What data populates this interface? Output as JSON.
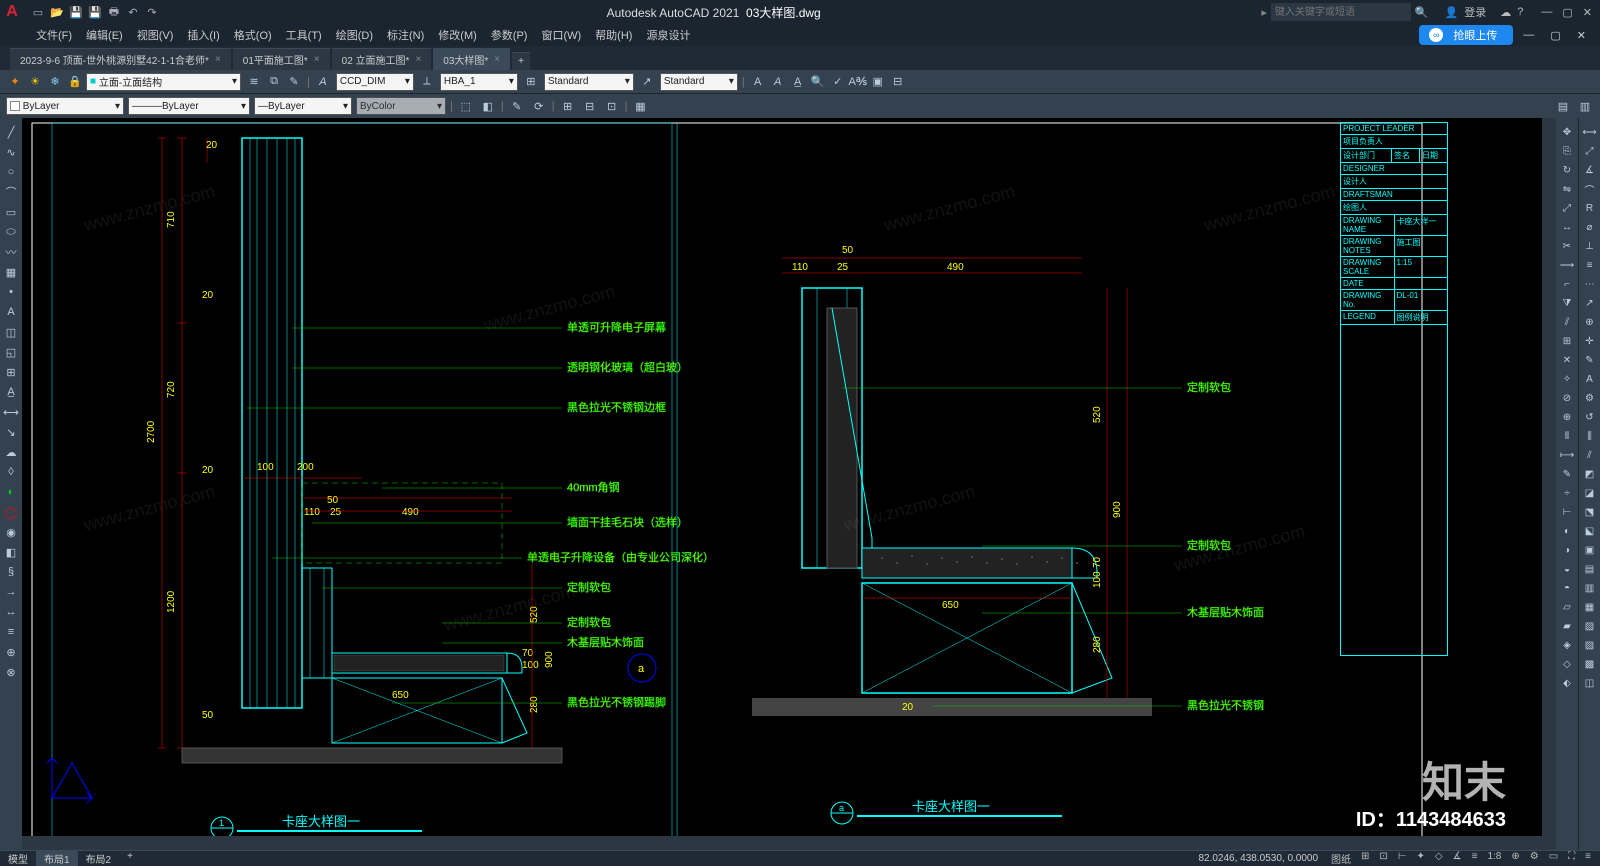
{
  "titlebar": {
    "logo": "A",
    "app": "Autodesk AutoCAD 2021",
    "file": "03大样图.dwg",
    "search_ph": "键入关键字或短语",
    "login": "登录"
  },
  "menu": [
    "文件(F)",
    "编辑(E)",
    "视图(V)",
    "插入(I)",
    "格式(O)",
    "工具(T)",
    "绘图(D)",
    "标注(N)",
    "修改(M)",
    "参数(P)",
    "窗口(W)",
    "帮助(H)",
    "源泉设计"
  ],
  "upload": "抢眼上传",
  "tabs": [
    "2023-9-6 顶面-世外桃源别墅42-1-1合老师*",
    "01平面施工图*",
    "02 立面施工图*",
    "03大样图*"
  ],
  "toolbar": {
    "layer_cb": "立面-立面结构",
    "style1": "CCD_DIM",
    "style2": "HBA_1",
    "style3": "Standard",
    "style4": "Standard",
    "bylayer": "ByLayer",
    "bycolor": "ByColor"
  },
  "drawing": {
    "left_dims": {
      "h_total": "2700",
      "h_top": "710",
      "h_mid": "720",
      "h_low": "1200",
      "w1": "100",
      "w2": "200",
      "w3": "50",
      "w4": "110",
      "w5": "25",
      "w6": "490",
      "w7": "650",
      "v1": "520",
      "v2": "280",
      "small1": "20",
      "small2": "50"
    },
    "right_dims": {
      "d1": "50",
      "d2": "110",
      "d3": "25",
      "d4": "490",
      "d5": "520",
      "d6": "70",
      "d7": "100",
      "d8": "650",
      "d9": "280",
      "d10": "20",
      "h900": "900"
    },
    "labels_left": [
      "单透可升降电子屏幕",
      "透明钢化玻璃（超白玻）",
      "黑色拉光不锈钢边框",
      "40mm角钢",
      "墙面干挂毛石块（选样）",
      "单透电子升降设备（由专业公司深化）",
      "定制软包",
      "定制软包",
      "木基层贴木饰面",
      "黑色拉光不锈钢踢脚"
    ],
    "labels_right": [
      "定制软包",
      "定制软包",
      "木基层贴木饰面",
      "黑色拉光不锈钢"
    ],
    "view_a": "a",
    "view_title": "卡座大样图一",
    "view_scale": "1:15"
  },
  "titleblock": {
    "r1": "PROJECT LEADER",
    "r2": "项目负责人",
    "r3": "设计部门",
    "r4": "DESIGNER",
    "r5": "设计人",
    "r6": "DRAFTSMAN",
    "r7": "绘图人",
    "r8": "DRAWING NAME",
    "r8v": "卡座大样一",
    "r9": "DRAWING NOTES",
    "r9v": "施工图",
    "r10": "DRAWING SCALE",
    "r10v": "1:15",
    "r11": "DATE",
    "r11v": "",
    "r12": "DRAWING No.",
    "r12v": "DL-01",
    "r13": "LEGEND",
    "r13v": "图例说明"
  },
  "status": {
    "layouts": [
      "模型",
      "布局1",
      "布局2"
    ],
    "active_layout": 1,
    "coords": "82.0246, 438.0530, 0.0000",
    "paper": "图纸",
    "scale": "1:8"
  },
  "watermark_brand": "知末",
  "watermark_url": "www.znzmo.com",
  "watermark_id": "ID：1143484633"
}
